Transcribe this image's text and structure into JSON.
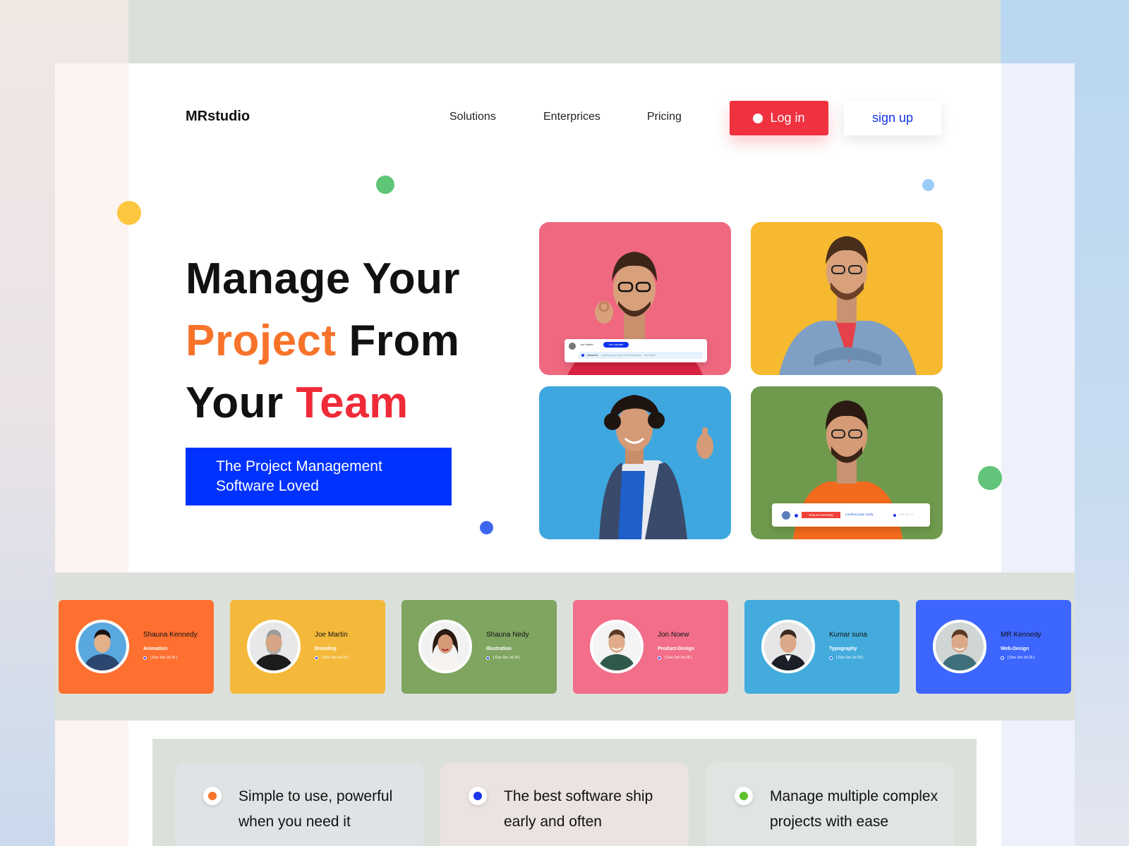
{
  "header": {
    "logo": "MRstudio",
    "nav": [
      "Solutions",
      "Enterprices",
      "Pricing"
    ],
    "login_label": "Log in",
    "signup_label": "sign up"
  },
  "hero": {
    "line1": "Manage Your",
    "line2_accent": "Project",
    "line2_rest": "From",
    "line3_start": "Your",
    "line3_accent": "Team",
    "cta_line1": "The Project Management",
    "cta_line2": "Software Loved"
  },
  "photo_overlays": {
    "card1_name": "Joe Martin",
    "card1_tag": "sub-update",
    "card1_item": "Milestone:",
    "card1_desc": "Landing page ready for development",
    "card1_meta": "Due Sep 5",
    "card2_name": "Shauna Kennedy",
    "card2_desc": "Landing page ready",
    "card2_meta": "Due Oct 10"
  },
  "team": [
    {
      "name": "Shauna Kennedy",
      "role": "Animation",
      "due": "[ Due Set Jul 26 ]",
      "color": "#fe7030"
    },
    {
      "name": "Joe Martin",
      "role": "Branding",
      "due": "[ Due Set Jul 26 ]",
      "color": "#f4b93a"
    },
    {
      "name": "Shauna Nedy",
      "role": "Illustration",
      "due": "[ Due Set Jul 26 ]",
      "color": "#7fa561"
    },
    {
      "name": "Jon Noew",
      "role": "Product-Design",
      "due": "[ Due Set Jul 26 ]",
      "color": "#f26e89"
    },
    {
      "name": "Kumar suna",
      "role": "Typography",
      "due": "[ Due Set Jul 26 ]",
      "color": "#43acdd"
    },
    {
      "name": "MR Kennedy",
      "role": "Web-Design",
      "due": "[ Due Set Jul 26 ]",
      "color": "#3d66ff"
    }
  ],
  "features": [
    {
      "text": "Simple to use, powerful when you need it",
      "dot": "#f8732a"
    },
    {
      "text": "The best software ship early and often",
      "dot": "#1d34e8"
    },
    {
      "text": "Manage multiple complex projects with ease",
      "dot": "#5fc12b"
    }
  ],
  "colors": {
    "accent_red": "#f0313f",
    "accent_blue": "#0032ff",
    "accent_orange": "#f8732a"
  }
}
